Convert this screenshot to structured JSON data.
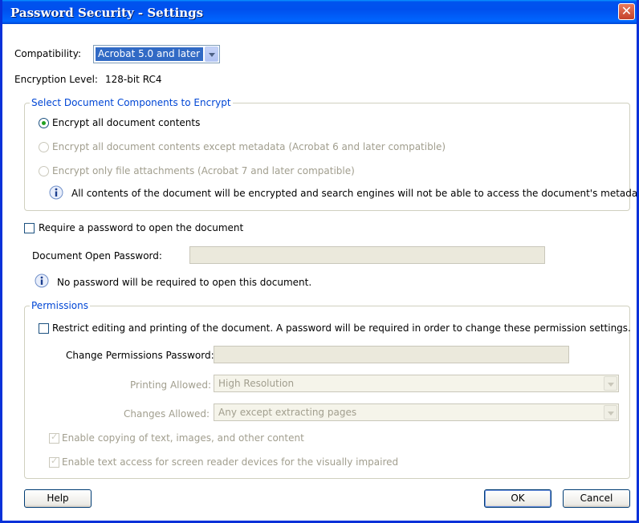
{
  "window": {
    "title": "Password Security - Settings",
    "close_glyph": "✕"
  },
  "compatibility": {
    "label": "Compatibility:",
    "selected": "Acrobat 5.0 and later"
  },
  "encryption": {
    "label": "Encryption Level:",
    "value": "128-bit RC4"
  },
  "components": {
    "legend": "Select Document Components to Encrypt",
    "options": [
      {
        "label": "Encrypt all document contents",
        "checked": true,
        "enabled": true
      },
      {
        "label": "Encrypt all document contents except metadata (Acrobat 6 and later compatible)",
        "checked": false,
        "enabled": false
      },
      {
        "label": "Encrypt only file attachments (Acrobat 7 and later compatible)",
        "checked": false,
        "enabled": false
      }
    ],
    "info": "All contents of the document will be encrypted and search engines will not be able to access the document's metadata."
  },
  "open_password": {
    "checkbox_label": "Require a password to open the document",
    "field_label": "Document Open Password:",
    "field_value": "",
    "info": "No password will be required to open this document."
  },
  "permissions": {
    "legend": "Permissions",
    "restrict_label": "Restrict editing and printing of the document. A password will be required in order to change these permission settings.",
    "change_password_label": "Change Permissions Password:",
    "change_password_value": "",
    "printing_label": "Printing Allowed:",
    "printing_value": "High Resolution",
    "changes_label": "Changes Allowed:",
    "changes_value": "Any except extracting pages",
    "copy_label": "Enable copying of text, images, and other content",
    "screen_reader_label": "Enable text access for screen reader devices for the visually impaired"
  },
  "buttons": {
    "help": "Help",
    "ok": "OK",
    "cancel": "Cancel"
  },
  "colors": {
    "titlebar": "#0053ee",
    "legend": "#0046d5",
    "accent": "#21a121"
  }
}
